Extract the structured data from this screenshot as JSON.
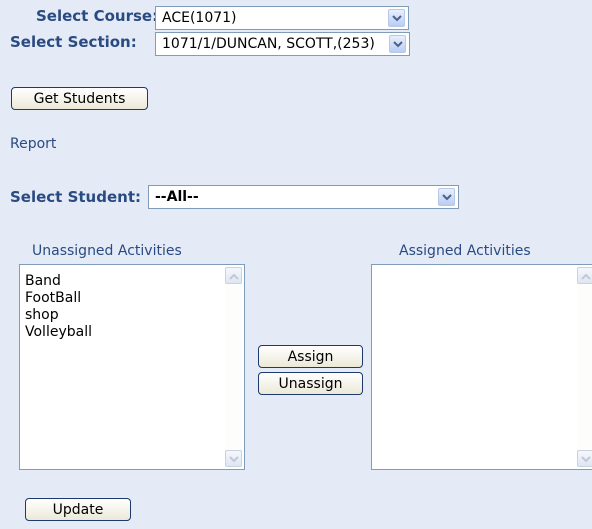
{
  "course": {
    "label": "Select Course:",
    "value": "ACE(1071)"
  },
  "section": {
    "label": "Select Section:",
    "value": "1071/1/DUNCAN, SCOTT,(253)"
  },
  "get_students_label": "Get Students",
  "report_link": "Report",
  "student": {
    "label": "Select Student:",
    "value": "--All--"
  },
  "unassigned": {
    "heading": "Unassigned Activities",
    "items": [
      "Band",
      "FootBall",
      "shop",
      "Volleyball"
    ]
  },
  "assigned": {
    "heading": "Assigned Activities",
    "items": []
  },
  "assign_label": "Assign",
  "unassign_label": "Unassign",
  "update_label": "Update",
  "icons": {
    "dropdown": "chevron-down-icon",
    "scroll_up": "scroll-up-arrow-icon",
    "scroll_down": "scroll-down-arrow-icon"
  },
  "colors": {
    "background": "#e4ebf6",
    "label": "#2a4a82",
    "border": "#7f9db9"
  }
}
